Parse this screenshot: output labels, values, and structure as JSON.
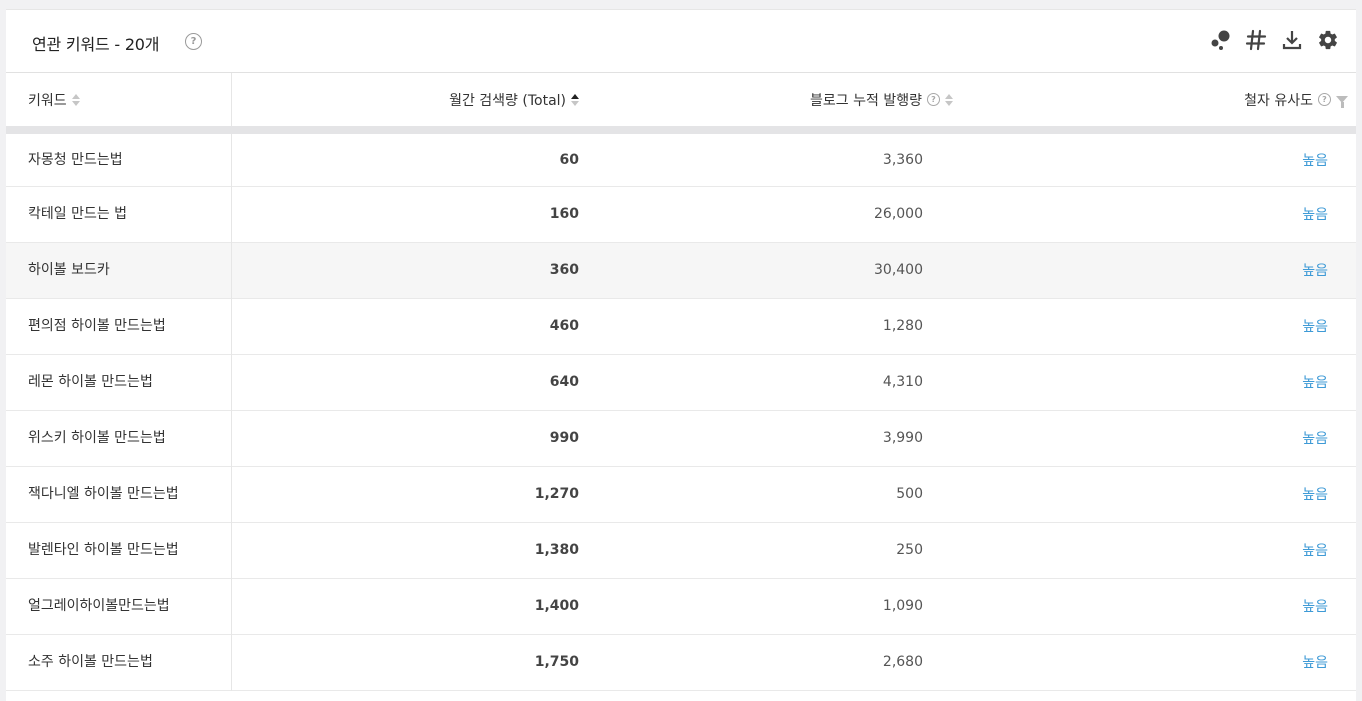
{
  "header": {
    "title": "연관 키워드 - 20개",
    "help_glyph": "?",
    "toolbar_icons": [
      "bubble-chart-icon",
      "hash-icon",
      "download-icon",
      "gear-icon"
    ]
  },
  "table": {
    "columns": {
      "keyword": "키워드",
      "volume": "월간 검색량 (Total)",
      "blog": "블로그 누적 발행량",
      "similarity": "철자 유사도"
    },
    "rows": [
      {
        "keyword": "자몽청 만드는법",
        "volume": "60",
        "blog": "3,360",
        "similarity": "높음"
      },
      {
        "keyword": "칵테일 만드는 법",
        "volume": "160",
        "blog": "26,000",
        "similarity": "높음"
      },
      {
        "keyword": "하이볼 보드카",
        "volume": "360",
        "blog": "30,400",
        "similarity": "높음"
      },
      {
        "keyword": "편의점 하이볼 만드는법",
        "volume": "460",
        "blog": "1,280",
        "similarity": "높음"
      },
      {
        "keyword": "레몬 하이볼 만드는법",
        "volume": "640",
        "blog": "4,310",
        "similarity": "높음"
      },
      {
        "keyword": "위스키 하이볼 만드는법",
        "volume": "990",
        "blog": "3,990",
        "similarity": "높음"
      },
      {
        "keyword": "잭다니엘 하이볼 만드는법",
        "volume": "1,270",
        "blog": "500",
        "similarity": "높음"
      },
      {
        "keyword": "발렌타인 하이볼 만드는법",
        "volume": "1,380",
        "blog": "250",
        "similarity": "높음"
      },
      {
        "keyword": "얼그레이하이볼만드는법",
        "volume": "1,400",
        "blog": "1,090",
        "similarity": "높음"
      },
      {
        "keyword": "소주 하이볼 만드는법",
        "volume": "1,750",
        "blog": "2,680",
        "similarity": "높음"
      }
    ]
  },
  "colors": {
    "link": "#3e9ad6",
    "divider": "#e4e4e6"
  }
}
